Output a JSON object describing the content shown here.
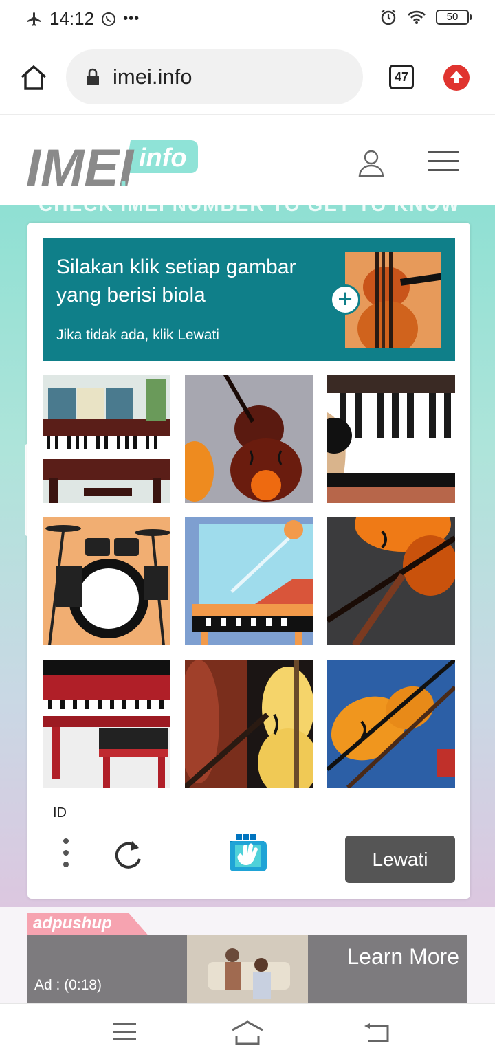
{
  "status_bar": {
    "time": "14:12",
    "more": "•••",
    "battery": "50"
  },
  "browser": {
    "url": "imei.info",
    "tab_count": "47"
  },
  "site": {
    "logo_main": "IMEI",
    "logo_dot": ".",
    "logo_sub": "info",
    "behind_text": "CHECK IMEI NUMBER TO GET TO KNOW"
  },
  "captcha": {
    "prompt_line1": "Silakan klik setiap gambar yang berisi biola",
    "prompt_sub": "Jika tidak ada, klik Lewati",
    "plus": "+",
    "language": "ID",
    "skip_label": "Lewati",
    "tiles": [
      "piano-room",
      "violin",
      "piano-keys",
      "drum-kit",
      "grand-piano",
      "violin-dark",
      "red-piano",
      "violin-yellow",
      "violin-blue"
    ]
  },
  "ad": {
    "brand": "adpushup",
    "timer": "Ad : (0:18)",
    "cta": "Learn More"
  },
  "colors": {
    "prompt_bg": "#0f7f89",
    "skip_bg": "#555555",
    "accent_red": "#e0342f",
    "logo_teal": "#7ee0d3"
  }
}
